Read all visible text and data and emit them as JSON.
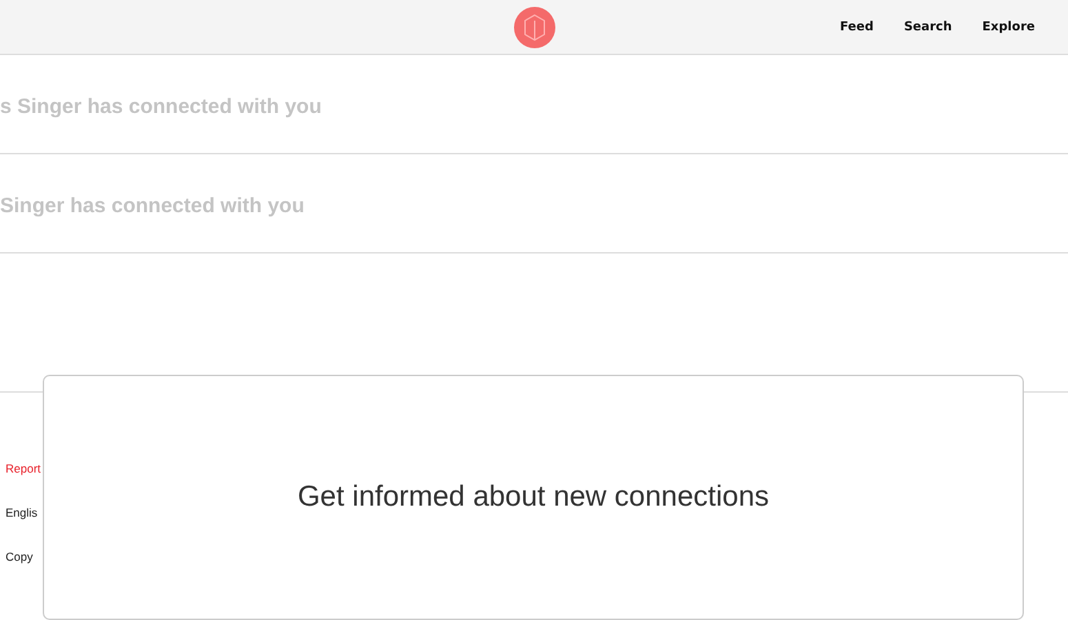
{
  "header": {
    "nav": [
      "Feed",
      "Search",
      "Explore"
    ]
  },
  "notifications": [
    "s Singer has connected with you",
    "Singer has connected with you"
  ],
  "footer": {
    "links": [
      {
        "label": "Report",
        "kind": "alert"
      },
      {
        "label": "Englis",
        "kind": "plain"
      },
      {
        "label": "Copy",
        "kind": "plain"
      }
    ]
  },
  "modal": {
    "title": "Get informed about new connections"
  }
}
